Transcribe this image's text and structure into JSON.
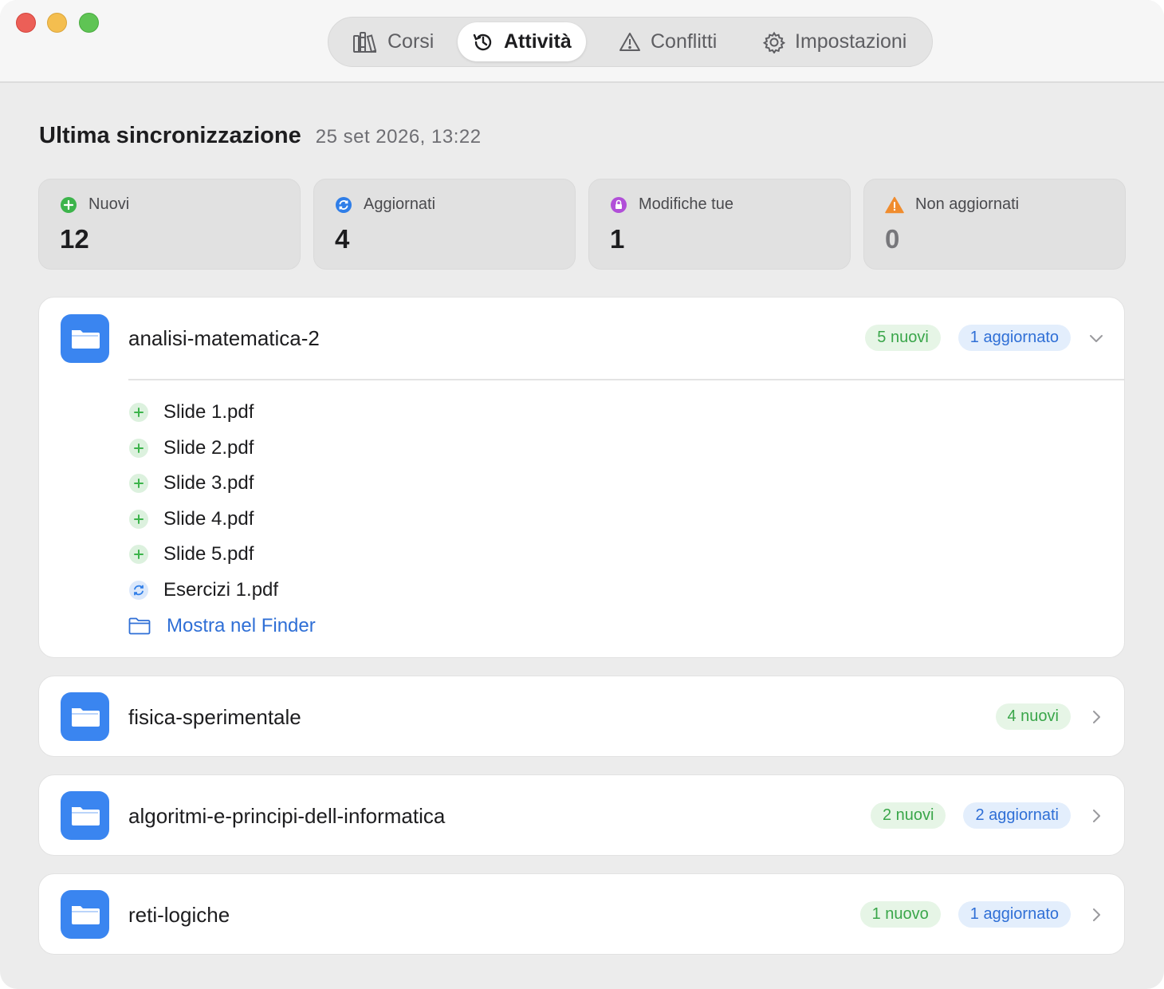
{
  "toolbar": {
    "tabs": [
      {
        "label": "Corsi",
        "icon": "books-icon"
      },
      {
        "label": "Attività",
        "icon": "history-icon",
        "active": true
      },
      {
        "label": "Conflitti",
        "icon": "warning-icon"
      },
      {
        "label": "Impostazioni",
        "icon": "gear-icon"
      }
    ]
  },
  "sync": {
    "title": "Ultima sincronizzazione",
    "timestamp": "25 set 2026, 13:22"
  },
  "stats": [
    {
      "label": "Nuovi",
      "value": "12",
      "color": "#3cb44b",
      "icon": "plus-circle-icon"
    },
    {
      "label": "Aggiornati",
      "value": "4",
      "color": "#2f7ee8",
      "icon": "sync-circle-icon"
    },
    {
      "label": "Modifiche tue",
      "value": "1",
      "color": "#b14fd8",
      "icon": "lock-circle-icon"
    },
    {
      "label": "Non aggiornati",
      "value": "0",
      "color": "#f08c2e",
      "icon": "warning-triangle-icon"
    }
  ],
  "courses": [
    {
      "name": "analisi-matematica-2",
      "badges": [
        {
          "text": "5 nuovi",
          "kind": "green"
        },
        {
          "text": "1 aggiornato",
          "kind": "blue"
        }
      ],
      "expanded": true,
      "files": [
        {
          "name": "Slide 1.pdf",
          "status": "new"
        },
        {
          "name": "Slide 2.pdf",
          "status": "new"
        },
        {
          "name": "Slide 3.pdf",
          "status": "new"
        },
        {
          "name": "Slide 4.pdf",
          "status": "new"
        },
        {
          "name": "Slide 5.pdf",
          "status": "new"
        },
        {
          "name": "Esercizi 1.pdf",
          "status": "updated"
        }
      ],
      "finder_label": "Mostra nel Finder"
    },
    {
      "name": "fisica-sperimentale",
      "badges": [
        {
          "text": "4 nuovi",
          "kind": "green"
        }
      ],
      "expanded": false
    },
    {
      "name": "algoritmi-e-principi-dell-informatica",
      "badges": [
        {
          "text": "2 nuovi",
          "kind": "green"
        },
        {
          "text": "2 aggiornati",
          "kind": "blue"
        }
      ],
      "expanded": false
    },
    {
      "name": "reti-logiche",
      "badges": [
        {
          "text": "1 nuovo",
          "kind": "green"
        },
        {
          "text": "1 aggiornato",
          "kind": "blue"
        }
      ],
      "expanded": false
    }
  ]
}
